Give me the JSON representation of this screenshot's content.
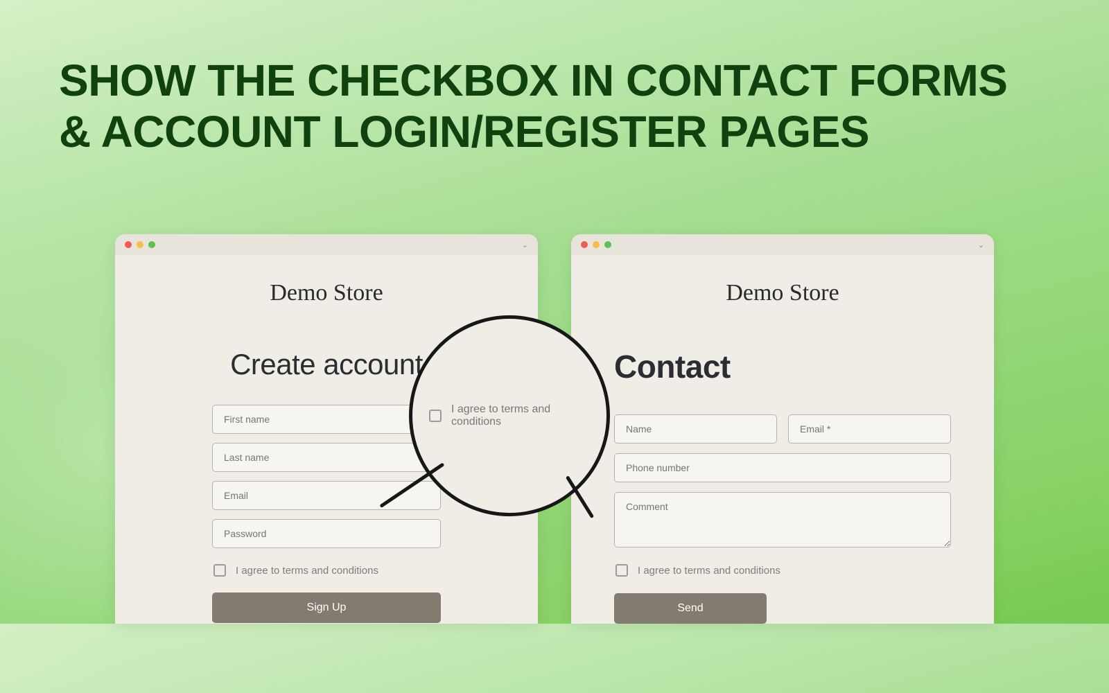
{
  "hero": "SHOW THE CHECKBOX IN CONTACT FORMS & ACCOUNT LOGIN/REGISTER PAGES",
  "left": {
    "store": "Demo Store",
    "heading": "Create account",
    "fields": {
      "first_name": "First name",
      "last_name": "Last name",
      "email": "Email",
      "password": "Password"
    },
    "agree": "I agree to terms and conditions",
    "button": "Sign Up"
  },
  "right": {
    "store": "Demo Store",
    "heading": "Contact",
    "fields": {
      "name": "Name",
      "email": "Email *",
      "phone": "Phone number",
      "comment": "Comment"
    },
    "agree": "I agree to terms and conditions",
    "button": "Send"
  },
  "magnifier": {
    "agree": "I agree to terms and conditions"
  }
}
